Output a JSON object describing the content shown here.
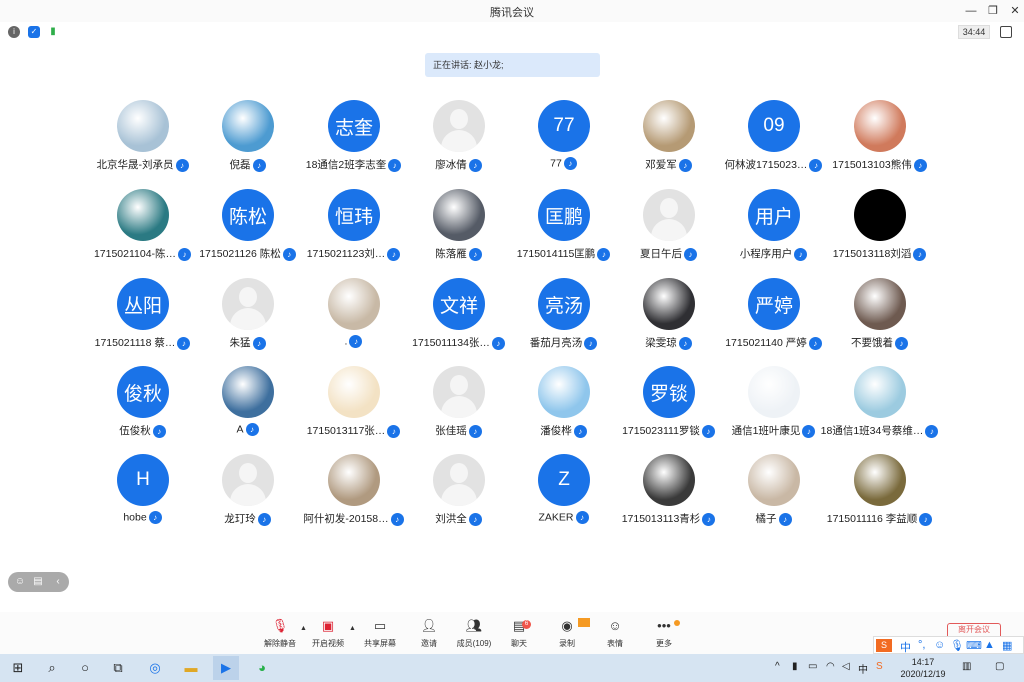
{
  "window": {
    "title": "腾讯会议"
  },
  "status": {
    "timer": "34:44"
  },
  "speaking": {
    "text": "正在讲话: 赵小龙;"
  },
  "participants": [
    {
      "name": "北京华晟-刘承员",
      "avatar": "photo",
      "avatar_color": "#a8c2d6"
    },
    {
      "name": "倪磊",
      "avatar": "photo",
      "avatar_color": "#4d9bd1"
    },
    {
      "name": "18通信2班李志奎",
      "avatar": "text",
      "avatar_text": "志奎"
    },
    {
      "name": "廖冰倩",
      "avatar": "blank"
    },
    {
      "name": "77",
      "avatar": "text",
      "avatar_text": "77"
    },
    {
      "name": "邓爱军",
      "avatar": "photo",
      "avatar_color": "#b59a74"
    },
    {
      "name": "何林波1715023…",
      "avatar": "text",
      "avatar_text": "09"
    },
    {
      "name": "1715013103熊伟",
      "avatar": "photo",
      "avatar_color": "#d07a5c"
    },
    {
      "name": "1715021104-陈…",
      "avatar": "photo",
      "avatar_color": "#2b7a83"
    },
    {
      "name": "1715021126 陈松",
      "avatar": "text",
      "avatar_text": "陈松"
    },
    {
      "name": "1715021123刘…",
      "avatar": "text",
      "avatar_text": "恒玮"
    },
    {
      "name": "陈落雁",
      "avatar": "photo",
      "avatar_color": "#555b66"
    },
    {
      "name": "1715014115匡鹏",
      "avatar": "text",
      "avatar_text": "匡鹏"
    },
    {
      "name": "夏日午后",
      "avatar": "blank"
    },
    {
      "name": "小程序用户",
      "avatar": "text",
      "avatar_text": "用户"
    },
    {
      "name": "1715013118刘滔",
      "avatar": "black"
    },
    {
      "name": "1715021118 蔡…",
      "avatar": "text",
      "avatar_text": "丛阳"
    },
    {
      "name": "朱猛",
      "avatar": "blank"
    },
    {
      "name": ".",
      "avatar": "photo",
      "avatar_color": "#c8b9a6"
    },
    {
      "name": "1715011134张…",
      "avatar": "text",
      "avatar_text": "文祥"
    },
    {
      "name": "番茄月亮汤",
      "avatar": "text",
      "avatar_text": "亮汤"
    },
    {
      "name": "梁雯琼",
      "avatar": "photo",
      "avatar_color": "#2f2f33"
    },
    {
      "name": "1715021140 严婷",
      "avatar": "text",
      "avatar_text": "严婷"
    },
    {
      "name": "不要饿着",
      "avatar": "photo",
      "avatar_color": "#6e5a50"
    },
    {
      "name": "伍俊秋",
      "avatar": "text",
      "avatar_text": "俊秋"
    },
    {
      "name": "A",
      "avatar": "photo",
      "avatar_color": "#3e6f9e"
    },
    {
      "name": "1715013117张…",
      "avatar": "photo",
      "avatar_color": "#f3e2c4"
    },
    {
      "name": "张佳瑶",
      "avatar": "blank"
    },
    {
      "name": "潘俊桦",
      "avatar": "photo",
      "avatar_color": "#8fc6ec"
    },
    {
      "name": "1715023111罗锬",
      "avatar": "text",
      "avatar_text": "罗锬"
    },
    {
      "name": "通信1班叶康见",
      "avatar": "photo",
      "avatar_color": "#eef2f6"
    },
    {
      "name": "18通信1班34号蔡维…",
      "avatar": "photo",
      "avatar_color": "#9ccbe0"
    },
    {
      "name": "hobe",
      "avatar": "text",
      "avatar_text": "H"
    },
    {
      "name": "龙玎玲",
      "avatar": "blank"
    },
    {
      "name": "阿什初发-20158…",
      "avatar": "photo",
      "avatar_color": "#b09a80"
    },
    {
      "name": "刘洪全",
      "avatar": "blank"
    },
    {
      "name": "ZAKER",
      "avatar": "text",
      "avatar_text": "Z"
    },
    {
      "name": "1715013113青杉",
      "avatar": "photo",
      "avatar_color": "#3a3a3a"
    },
    {
      "name": "橘子",
      "avatar": "photo",
      "avatar_color": "#c9b8a5"
    },
    {
      "name": "1715011116 李益顺",
      "avatar": "photo",
      "avatar_color": "#7a6a3c"
    }
  ],
  "toolbar": {
    "unmute": "解除静音",
    "video": "开启视频",
    "share": "共享屏幕",
    "invite": "邀请",
    "members": "成员(109)",
    "chat": "聊天",
    "chat_badge": "6",
    "record": "录制",
    "reactions": "表情",
    "more": "更多"
  },
  "side_button": "离开会议",
  "ime": {
    "lang": "中",
    "punct": "°,"
  },
  "taskbar": {
    "time": "14:17",
    "date": "2020/12/19",
    "tray_lang": "中"
  },
  "colors": {
    "accent": "#1a73e8",
    "danger": "#f0554a"
  }
}
